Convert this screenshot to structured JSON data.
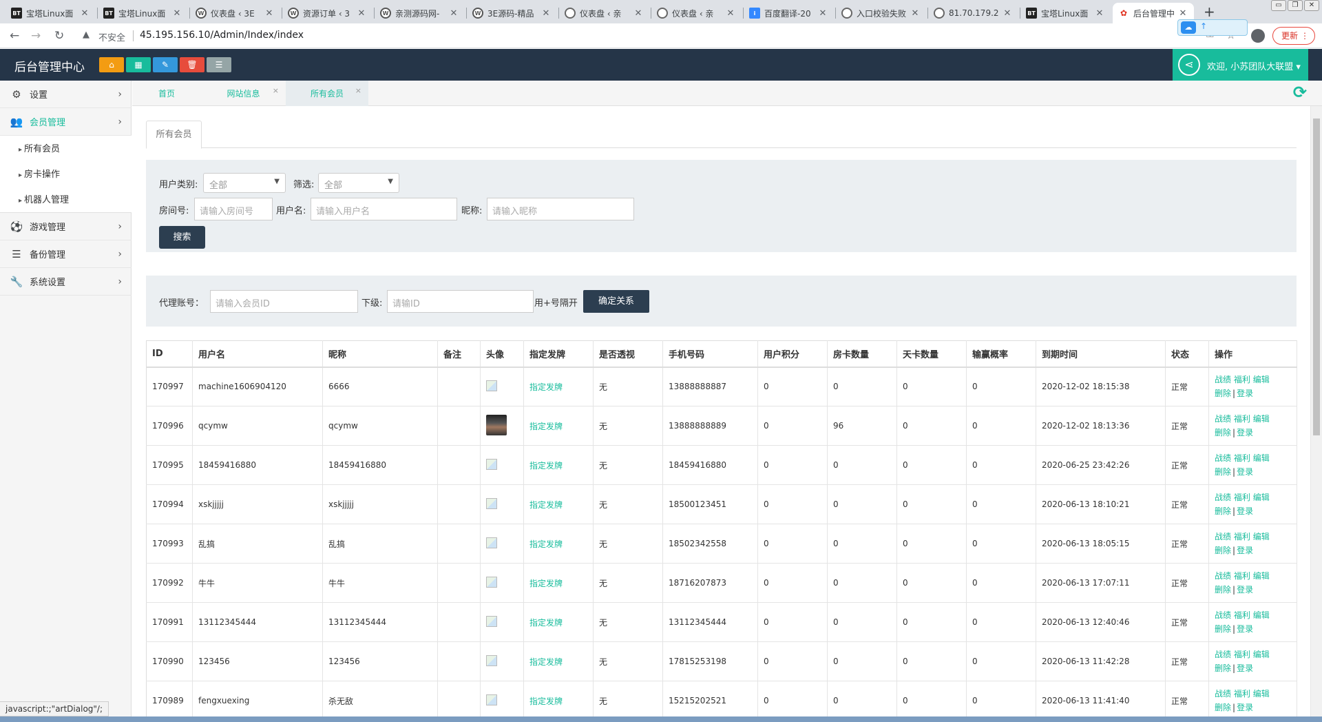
{
  "browser": {
    "tabs": [
      {
        "title": "宝塔Linux面",
        "favicon": "bt"
      },
      {
        "title": "宝塔Linux面",
        "favicon": "bt"
      },
      {
        "title": "仪表盘 ‹ 3E",
        "favicon": "wp"
      },
      {
        "title": "资源订单 ‹ 3",
        "favicon": "wp"
      },
      {
        "title": "亲测源码网-",
        "favicon": "wp"
      },
      {
        "title": "3E源码-精品",
        "favicon": "wp"
      },
      {
        "title": "仪表盘 ‹ 亲",
        "favicon": "globe"
      },
      {
        "title": "仪表盘 ‹ 亲",
        "favicon": "globe"
      },
      {
        "title": "百度翻译-20",
        "favicon": "baidu"
      },
      {
        "title": "入口校验失败",
        "favicon": "globe"
      },
      {
        "title": "81.70.179.2",
        "favicon": "globe"
      },
      {
        "title": "宝塔Linux面",
        "favicon": "bt"
      },
      {
        "title": "后台管理中心",
        "favicon": "red",
        "active": true
      }
    ],
    "new_tab": "+",
    "security_label": "不安全",
    "url": "45.195.156.10/Admin/Index/index",
    "update_label": "更新",
    "status_url": "javascript:;\"artDialog\"/;"
  },
  "header": {
    "brand": "后台管理中心",
    "quick_buttons": [
      {
        "name": "home-icon",
        "glyph": "⌂",
        "color": "#f39c12"
      },
      {
        "name": "grid-icon",
        "glyph": "▦",
        "color": "#18bc9c"
      },
      {
        "name": "pencil-icon",
        "glyph": "✎",
        "color": "#3498db"
      },
      {
        "name": "trash-icon",
        "glyph": "🗑",
        "color": "#e74c3c"
      },
      {
        "name": "list-icon",
        "glyph": "☰",
        "color": "#95a5a6"
      }
    ],
    "welcome": "欢迎, 小苏团队大联盟 ▾"
  },
  "sidebar": {
    "items": [
      {
        "label": "设置",
        "icon": "gears-icon",
        "glyph": "⚙"
      },
      {
        "label": "会员管理",
        "icon": "users-icon",
        "glyph": "👥",
        "active": true
      },
      {
        "label": "游戏管理",
        "icon": "soccer-ball-icon",
        "glyph": "⚽"
      },
      {
        "label": "备份管理",
        "icon": "database-icon",
        "glyph": "☰"
      },
      {
        "label": "系统设置",
        "icon": "wrench-icon",
        "glyph": "🔧"
      }
    ],
    "subitems": [
      "所有会员",
      "房卡操作",
      "机器人管理"
    ]
  },
  "content_tabs": [
    {
      "label": "首页"
    },
    {
      "label": "网站信息",
      "closable": true
    },
    {
      "label": "所有会员",
      "closable": true,
      "active": true
    }
  ],
  "page": {
    "tab": "所有会员",
    "filter": {
      "user_type_label": "用户类别:",
      "user_type_value": "全部",
      "filter_label": "筛选:",
      "filter_value": "全部",
      "room_label": "房间号:",
      "room_placeholder": "请输入房间号",
      "username_label": "用户名:",
      "username_placeholder": "请输入用户名",
      "nickname_label": "昵称:",
      "nickname_placeholder": "请输入昵称",
      "search_button": "搜索"
    },
    "agent": {
      "account_label": "代理账号：",
      "account_placeholder": "请输入会员ID",
      "sub_label": "下级:",
      "sub_placeholder": "请输ID",
      "hint": "用+号隔开",
      "confirm_button": "确定关系"
    }
  },
  "table": {
    "columns": [
      "ID",
      "用户名",
      "昵称",
      "备注",
      "头像",
      "指定发牌",
      "是否透视",
      "手机号码",
      "用户积分",
      "房卡数量",
      "天卡数量",
      "输赢概率",
      "到期时间",
      "状态",
      "操作"
    ],
    "deal_link": "指定发牌",
    "ops": {
      "record": "战绩",
      "benefit": "福利",
      "edit": "编辑",
      "delete": "删除",
      "login": "登录",
      "sep": "|"
    },
    "rows": [
      {
        "id": "170997",
        "username": "machine1606904120",
        "nickname": "6666",
        "note": "",
        "avatar": "broken",
        "xray": "无",
        "phone": "13888888887",
        "points": "0",
        "room_cards": "0",
        "day_cards": "0",
        "win_rate": "0",
        "expires": "2020-12-02 18:15:38",
        "status": "正常"
      },
      {
        "id": "170996",
        "username": "qcymw",
        "nickname": "qcymw",
        "note": "",
        "avatar": "photo",
        "xray": "无",
        "phone": "13888888889",
        "points": "0",
        "room_cards": "96",
        "day_cards": "0",
        "win_rate": "0",
        "expires": "2020-12-02 18:13:36",
        "status": "正常"
      },
      {
        "id": "170995",
        "username": "18459416880",
        "nickname": "18459416880",
        "note": "",
        "avatar": "broken",
        "xray": "无",
        "phone": "18459416880",
        "points": "0",
        "room_cards": "0",
        "day_cards": "0",
        "win_rate": "0",
        "expires": "2020-06-25 23:42:26",
        "status": "正常"
      },
      {
        "id": "170994",
        "username": "xskjjjjj",
        "nickname": "xskjjjjj",
        "note": "",
        "avatar": "broken",
        "xray": "无",
        "phone": "18500123451",
        "points": "0",
        "room_cards": "0",
        "day_cards": "0",
        "win_rate": "0",
        "expires": "2020-06-13 18:10:21",
        "status": "正常"
      },
      {
        "id": "170993",
        "username": "乱搞",
        "nickname": "乱搞",
        "note": "",
        "avatar": "broken",
        "xray": "无",
        "phone": "18502342558",
        "points": "0",
        "room_cards": "0",
        "day_cards": "0",
        "win_rate": "0",
        "expires": "2020-06-13 18:05:15",
        "status": "正常"
      },
      {
        "id": "170992",
        "username": "牛牛",
        "nickname": "牛牛",
        "note": "",
        "avatar": "broken",
        "xray": "无",
        "phone": "18716207873",
        "points": "0",
        "room_cards": "0",
        "day_cards": "0",
        "win_rate": "0",
        "expires": "2020-06-13 17:07:11",
        "status": "正常"
      },
      {
        "id": "170991",
        "username": "13112345444",
        "nickname": "13112345444",
        "note": "",
        "avatar": "broken",
        "xray": "无",
        "phone": "13112345444",
        "points": "0",
        "room_cards": "0",
        "day_cards": "0",
        "win_rate": "0",
        "expires": "2020-06-13 12:40:46",
        "status": "正常"
      },
      {
        "id": "170990",
        "username": "123456",
        "nickname": "123456",
        "note": "",
        "avatar": "broken",
        "xray": "无",
        "phone": "17815253198",
        "points": "0",
        "room_cards": "0",
        "day_cards": "0",
        "win_rate": "0",
        "expires": "2020-06-13 11:42:28",
        "status": "正常"
      },
      {
        "id": "170989",
        "username": "fengxuexing",
        "nickname": "杀无敌",
        "note": "",
        "avatar": "broken",
        "xray": "无",
        "phone": "15215202521",
        "points": "0",
        "room_cards": "0",
        "day_cards": "0",
        "win_rate": "0",
        "expires": "2020-06-13 11:41:40",
        "status": "正常"
      }
    ]
  }
}
